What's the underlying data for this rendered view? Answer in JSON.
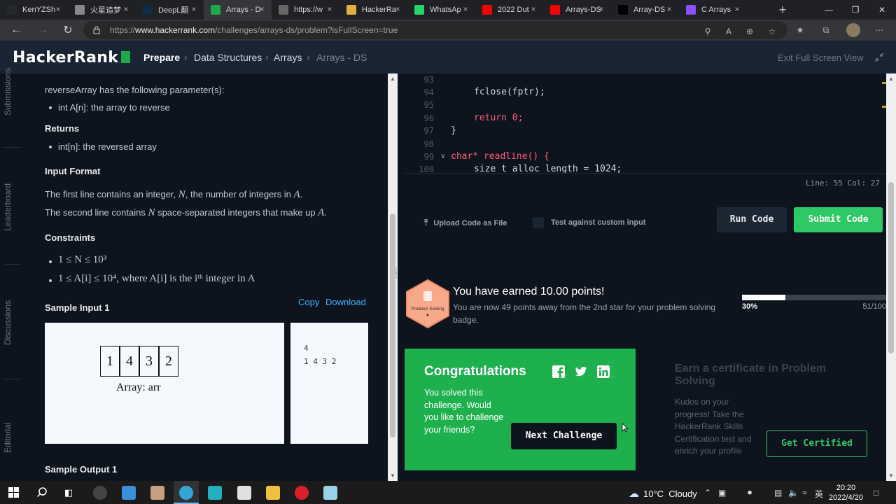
{
  "browser": {
    "tabs": [
      {
        "label": "KenYZSh",
        "icon": "github-icon",
        "color": "#24292e"
      },
      {
        "label": "火星追梦",
        "icon": "page-icon",
        "color": "#888888"
      },
      {
        "label": "DeepL翻",
        "icon": "deepl-icon",
        "color": "#0f2b46"
      },
      {
        "label": "Arrays - D",
        "icon": "hackerrank-icon",
        "color": "#1ba94c"
      },
      {
        "label": "https://w",
        "icon": "document-icon",
        "color": "#666666"
      },
      {
        "label": "HackerRa",
        "icon": "hackerrank-icon",
        "color": "#e0b040"
      },
      {
        "label": "WhatsAp",
        "icon": "whatsapp-icon",
        "color": "#25d366"
      },
      {
        "label": "2022 Dut",
        "icon": "youtube-icon",
        "color": "#ff0000"
      },
      {
        "label": "Arrays-DS",
        "icon": "youtube-icon",
        "color": "#ff0000"
      },
      {
        "label": "Array-DS",
        "icon": "medium-icon",
        "color": "#000000"
      },
      {
        "label": "C Arrays",
        "icon": "page-icon",
        "color": "#8a4dff"
      }
    ],
    "active_tab_index": 3,
    "url_prefix": "https://",
    "url_domain": "www.hackerrank.com",
    "url_path": "/challenges/arrays-ds/problem?isFullScreen=true"
  },
  "header": {
    "logo": "HackerRank",
    "breadcrumb": [
      "Prepare",
      "Data Structures",
      "Arrays",
      "Arrays - DS"
    ],
    "exit_fullscreen": "Exit Full Screen View"
  },
  "rail": [
    "Submissions",
    "Leaderboard",
    "Discussions",
    "Editorial"
  ],
  "problem": {
    "params_intro": "reverseArray has the following parameter(s):",
    "param1": "int A[n]: the array to reverse",
    "returns_heading": "Returns",
    "returns_item": "int[n]: the reversed array",
    "input_format_heading": "Input Format",
    "input_line1_a": "The first line contains an integer,",
    "input_line1_var": "N",
    "input_line1_b": ", the number of integers in",
    "input_line1_var2": "A",
    "input_line2_a": "The second line contains",
    "input_line2_var": "N",
    "input_line2_b": "space-separated integers that make up",
    "input_line2_var2": "A",
    "constraints_heading": "Constraints",
    "constraint1": "1 ≤ N ≤ 10³",
    "constraint2": "1 ≤ A[i] ≤ 10⁴, where A[i] is the iᵗʰ integer in A",
    "sample_input_heading": "Sample Input 1",
    "copy": "Copy",
    "download": "Download",
    "array_cells": [
      "1",
      "4",
      "3",
      "2"
    ],
    "array_label": "Array: arr",
    "sample_line1": "4",
    "sample_line2": "1 4 3 2",
    "sample_output_heading": "Sample Output 1"
  },
  "editor": {
    "lines": [
      {
        "num": "93",
        "code": ""
      },
      {
        "num": "94",
        "code": "fclose(fptr);"
      },
      {
        "num": "95",
        "code": ""
      },
      {
        "num": "96",
        "code": "return 0;"
      },
      {
        "num": "97",
        "code": "}"
      },
      {
        "num": "98",
        "code": ""
      },
      {
        "num": "99",
        "code": "char* readline() {"
      },
      {
        "num": "100",
        "code": "size_t alloc_length = 1024;"
      }
    ],
    "status": "Line: 55 Col: 27"
  },
  "actions": {
    "upload": "Upload Code as File",
    "custom_input": "Test against custom input",
    "run": "Run Code",
    "submit": "Submit Code"
  },
  "result": {
    "badge_label": "Problem Solving",
    "earned": "You have earned 10.00 points!",
    "earned_sub": "You are now 49 points away from the 2nd star for your problem solving badge.",
    "progress_pct": "30%",
    "progress_value": 0.3,
    "progress_count": "51/100",
    "congrats_title": "Congratulations",
    "congrats_text": "You solved this challenge. Would you like to challenge your friends?",
    "next_challenge": "Next Challenge",
    "cert_title": "Earn a certificate in Problem Solving",
    "cert_text": "Kudos on your progress! Take the HackerRank Skills Certification test and enrich your profile",
    "get_certified": "Get Certified"
  },
  "taskbar": {
    "weather": "10°C  Cloudy",
    "time": "20:20",
    "date": "2022/4/20",
    "ime": "英"
  },
  "colors": {
    "brand_green": "#1ba94c",
    "submit_green": "#2ec866",
    "bg_dark": "#0e141e",
    "header_bg": "#1a2533",
    "badge_orange": "#f9a07a"
  }
}
